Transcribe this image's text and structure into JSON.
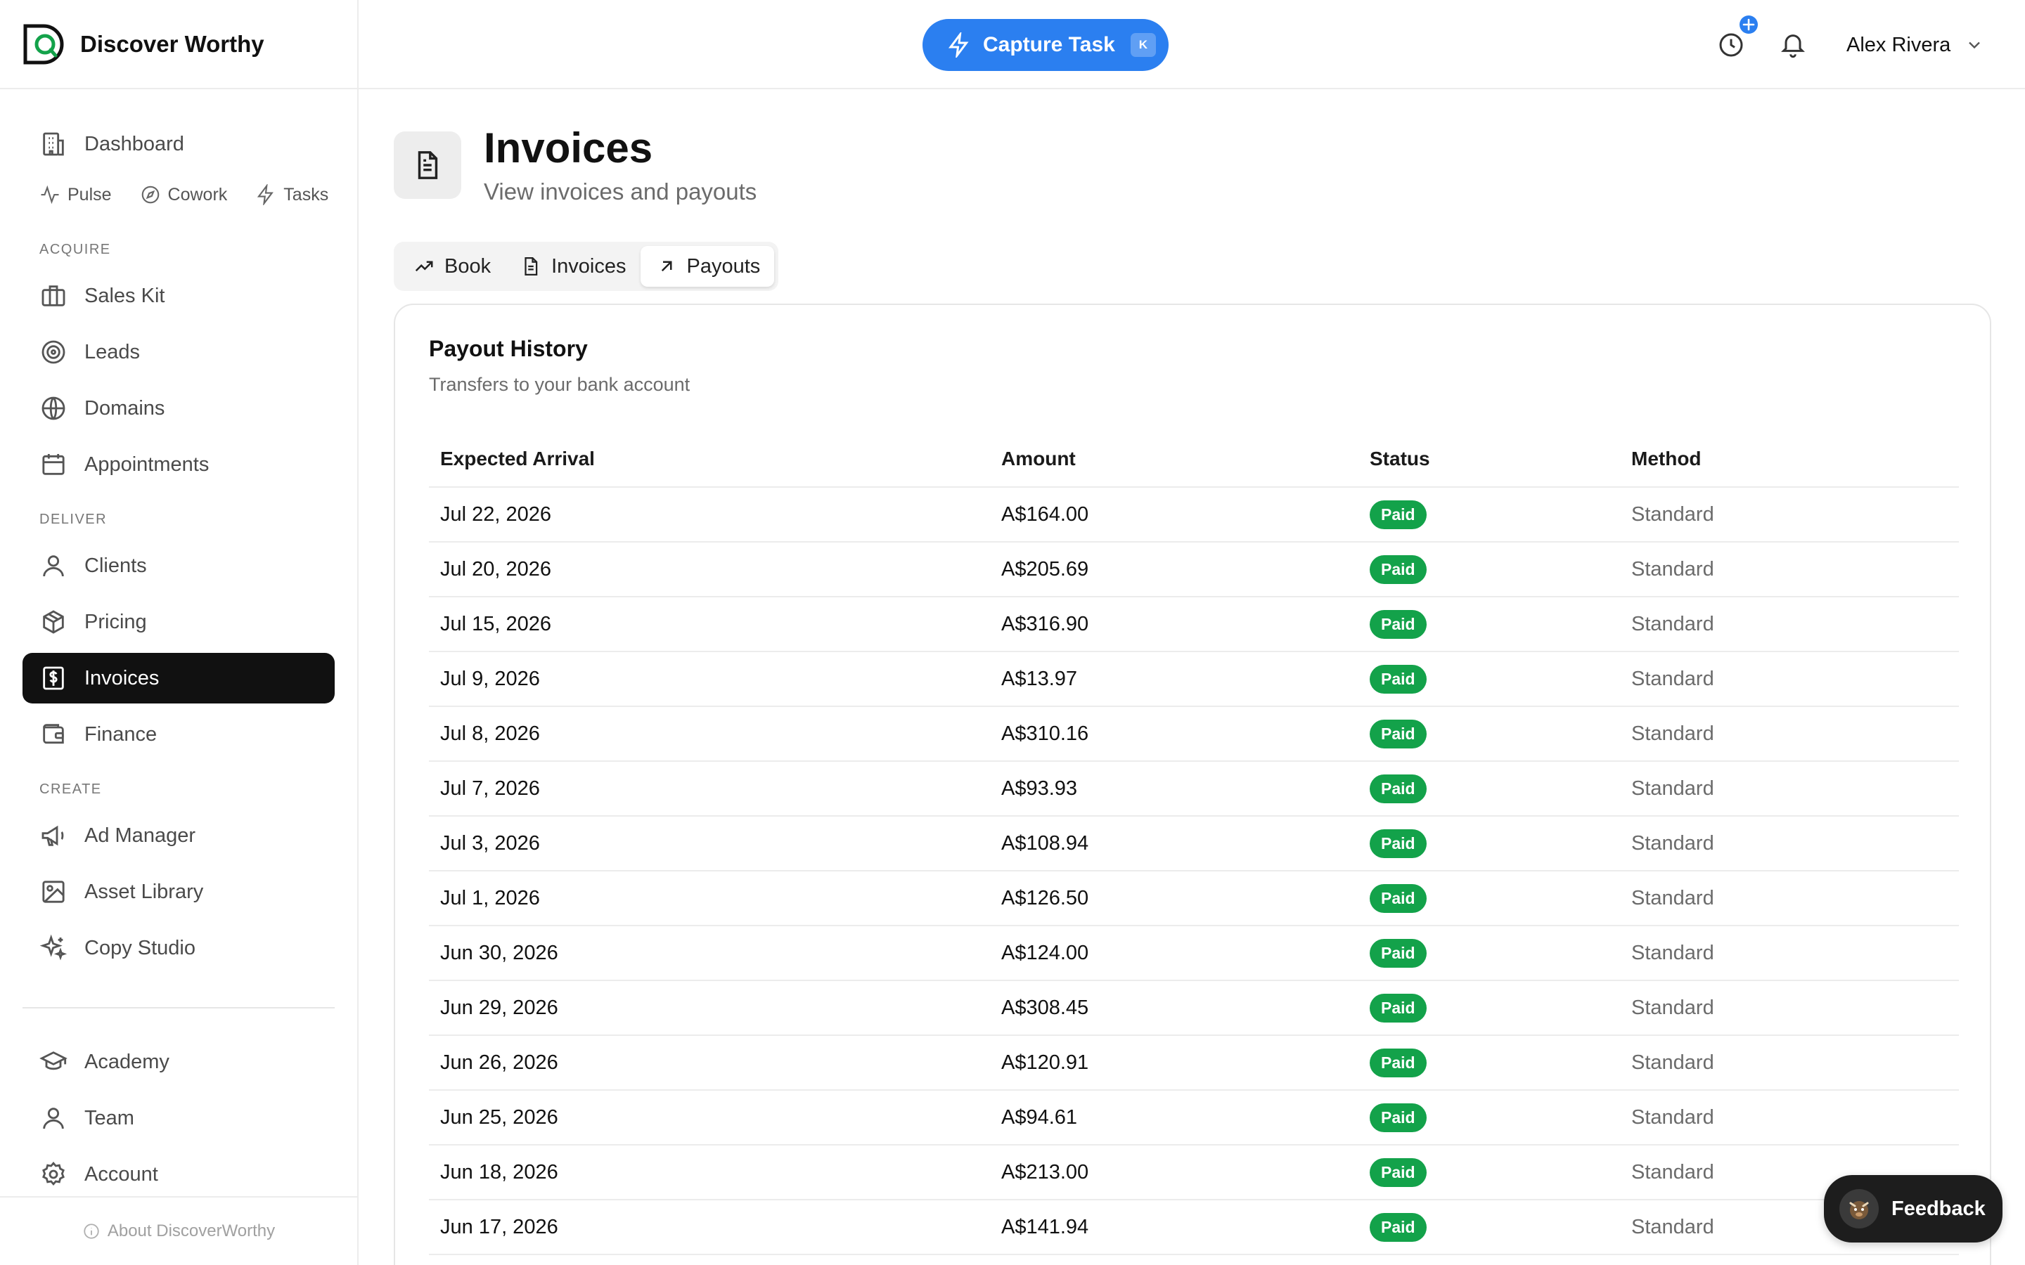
{
  "brand": {
    "name": "Discover Worthy"
  },
  "sidebar": {
    "dashboard": "Dashboard",
    "sub_items": [
      "Pulse",
      "Cowork",
      "Tasks"
    ],
    "sections": [
      {
        "label": "ACQUIRE",
        "items": [
          "Sales Kit",
          "Leads",
          "Domains",
          "Appointments"
        ]
      },
      {
        "label": "DELIVER",
        "items": [
          "Clients",
          "Pricing",
          "Invoices",
          "Finance"
        ]
      },
      {
        "label": "CREATE",
        "items": [
          "Ad Manager",
          "Asset Library",
          "Copy Studio"
        ]
      }
    ],
    "footer_items": [
      "Academy",
      "Team",
      "Account"
    ],
    "active": "Invoices",
    "about": "About DiscoverWorthy"
  },
  "topbar": {
    "capture_label": "Capture Task",
    "capture_shortcut": "K",
    "user_name": "Alex Rivera"
  },
  "page": {
    "title": "Invoices",
    "subtitle": "View invoices and payouts"
  },
  "tabs": [
    "Book",
    "Invoices",
    "Payouts"
  ],
  "active_tab": "Payouts",
  "card": {
    "title": "Payout History",
    "subtitle": "Transfers to your bank account"
  },
  "table": {
    "columns": [
      "Expected Arrival",
      "Amount",
      "Status",
      "Method"
    ],
    "rows": [
      [
        "Jul 22, 2026",
        "A$164.00",
        "Paid",
        "Standard"
      ],
      [
        "Jul 20, 2026",
        "A$205.69",
        "Paid",
        "Standard"
      ],
      [
        "Jul 15, 2026",
        "A$316.90",
        "Paid",
        "Standard"
      ],
      [
        "Jul 9, 2026",
        "A$13.97",
        "Paid",
        "Standard"
      ],
      [
        "Jul 8, 2026",
        "A$310.16",
        "Paid",
        "Standard"
      ],
      [
        "Jul 7, 2026",
        "A$93.93",
        "Paid",
        "Standard"
      ],
      [
        "Jul 3, 2026",
        "A$108.94",
        "Paid",
        "Standard"
      ],
      [
        "Jul 1, 2026",
        "A$126.50",
        "Paid",
        "Standard"
      ],
      [
        "Jun 30, 2026",
        "A$124.00",
        "Paid",
        "Standard"
      ],
      [
        "Jun 29, 2026",
        "A$308.45",
        "Paid",
        "Standard"
      ],
      [
        "Jun 26, 2026",
        "A$120.91",
        "Paid",
        "Standard"
      ],
      [
        "Jun 25, 2026",
        "A$94.61",
        "Paid",
        "Standard"
      ],
      [
        "Jun 18, 2026",
        "A$213.00",
        "Paid",
        "Standard"
      ],
      [
        "Jun 17, 2026",
        "A$141.94",
        "Paid",
        "Standard"
      ]
    ]
  },
  "feedback_label": "Feedback",
  "colors": {
    "accent": "#2b7ff0",
    "paid": "#13a24a",
    "active_nav": "#111111"
  }
}
